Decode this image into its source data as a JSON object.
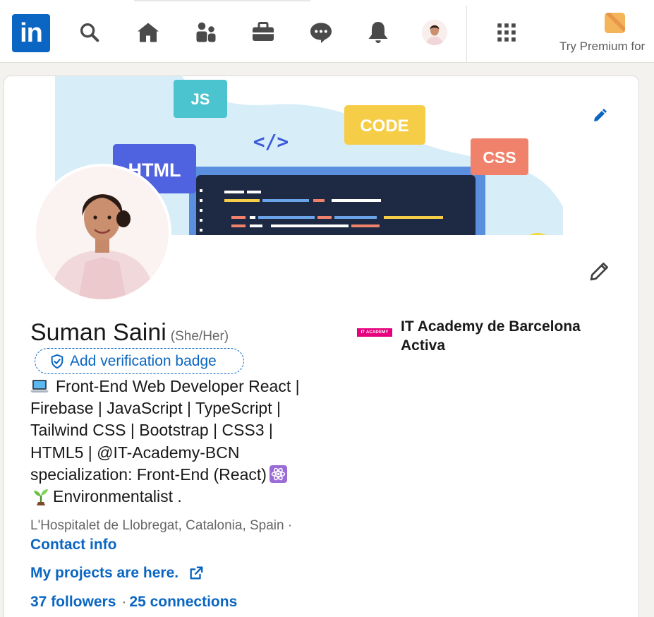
{
  "nav": {
    "logo_text": "in",
    "premium_label": "Try Premium for"
  },
  "profile": {
    "name": "Suman Saini",
    "pronouns": "(She/Her)",
    "verify_label": "Add verification badge",
    "headline_lines": [
      "Front-End Web Developer React |",
      "Firebase | JavaScript | TypeScript |",
      "Tailwind CSS | Bootstrap | CSS3 |",
      "HTML5 | @IT-Academy-BCN",
      "specialization: Front-End (React)",
      "Environmentalist ."
    ],
    "location": "L'Hospitalet de Llobregat, Catalonia, Spain ·",
    "contact_label": "Contact info",
    "website_label": "My projects are here.",
    "followers": "37 followers",
    "network_separator": "·",
    "connections": "25 connections"
  },
  "education": {
    "school_logo_text": "IT ACADEMY",
    "school_name": "IT Academy de Barcelona Activa"
  },
  "banner": {
    "tags": [
      "JS",
      "CODE",
      "</>",
      "HTML",
      "CSS"
    ]
  },
  "colors": {
    "brand_blue": "#0a66c2",
    "banner_bg": "#d7eef9",
    "js_tag": "#4cc4cf",
    "code_tag": "#f5cd47",
    "html_tag": "#4f63e0",
    "css_tag": "#f0826b",
    "school_logo": "#e6007e"
  }
}
